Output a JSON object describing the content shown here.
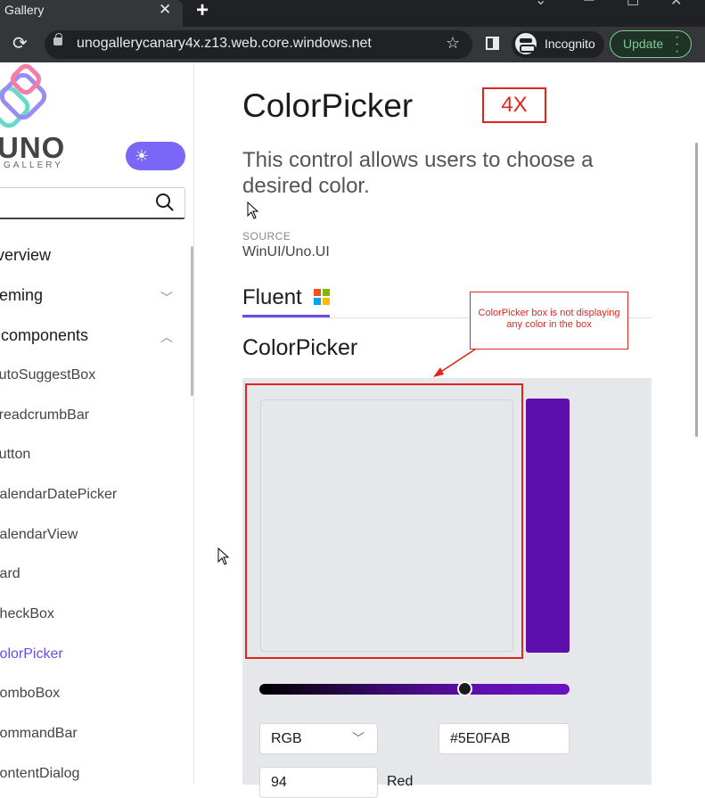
{
  "browser": {
    "tab_title": "Gallery",
    "tab_close": "✕",
    "new_tab": "+",
    "url": "unogallerycanary4x.z13.web.core.windows.net",
    "incognito_label": "Incognito",
    "update_label": "Update"
  },
  "sidebar": {
    "brand": "UNO",
    "brand_sub": "GALLERY",
    "search_placeholder": "",
    "items": [
      {
        "label": "Overview"
      },
      {
        "label": "Theming"
      },
      {
        "label": "UI components"
      }
    ],
    "components": [
      {
        "label": "AutoSuggestBox"
      },
      {
        "label": "BreadcrumbBar"
      },
      {
        "label": "Button"
      },
      {
        "label": "CalendarDatePicker"
      },
      {
        "label": "CalendarView"
      },
      {
        "label": "Card"
      },
      {
        "label": "CheckBox"
      },
      {
        "label": "ColorPicker",
        "selected": true
      },
      {
        "label": "ComboBox"
      },
      {
        "label": "CommandBar"
      },
      {
        "label": "ContentDialog"
      }
    ]
  },
  "main": {
    "title": "ColorPicker",
    "annotation_4x": "4X",
    "description": "This control allows users to choose a desired color.",
    "source_label": "SOURCE",
    "source_value": "WinUI/Uno.UI",
    "tab_label": "Fluent",
    "section_title": "ColorPicker",
    "callout_text": "ColorPicker box is not displaying any color in the box",
    "picker": {
      "mode": "RGB",
      "hex": "#5E0FAB",
      "red_value": "94",
      "red_label": "Red",
      "preview_color": "#5E0FAB"
    }
  },
  "colors": {
    "accent": "#6B4DE6",
    "annotation_red": "#E0261C"
  }
}
